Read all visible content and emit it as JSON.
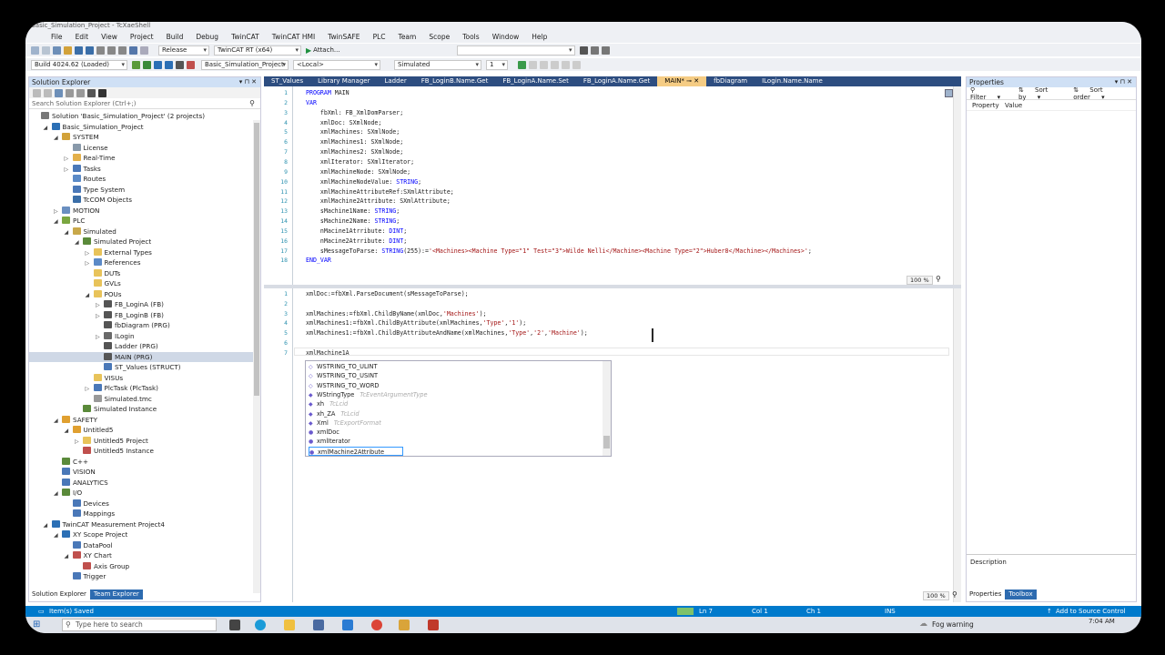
{
  "title": "Basic_Simulation_Project - TcXaeShell",
  "menu": [
    "File",
    "Edit",
    "View",
    "Project",
    "Build",
    "Debug",
    "TwinCAT",
    "TwinCAT HMI",
    "TwinSAFE",
    "PLC",
    "Team",
    "Scope",
    "Tools",
    "Window",
    "Help"
  ],
  "toolbar1": {
    "config": "Release",
    "platform": "TwinCAT RT (x64)",
    "attach": "Attach..."
  },
  "toolbar2": {
    "build": "Build 4024.62 (Loaded)",
    "project": "Basic_Simulation_Project",
    "target": "<Local>",
    "mode": "Simulated",
    "instance": "1"
  },
  "solution_explorer": {
    "title": "Solution Explorer",
    "controls": "▾ ⊓ ✕",
    "search_placeholder": "Search Solution Explorer (Ctrl+;)",
    "items": [
      {
        "label": "Solution 'Basic_Simulation_Project' (2 projects)",
        "level": 0,
        "arrow": "",
        "icon": "#777"
      },
      {
        "label": "Basic_Simulation_Project",
        "level": 1,
        "arrow": "◢",
        "icon": "#2b6fb5"
      },
      {
        "label": "SYSTEM",
        "level": 2,
        "arrow": "◢",
        "icon": "#d2a23a"
      },
      {
        "label": "License",
        "level": 3,
        "arrow": "",
        "icon": "#8899aa"
      },
      {
        "label": "Real-Time",
        "level": 3,
        "arrow": "▷",
        "icon": "#e3b04b"
      },
      {
        "label": "Tasks",
        "level": 3,
        "arrow": "▷",
        "icon": "#4a78b8"
      },
      {
        "label": "Routes",
        "level": 3,
        "arrow": "",
        "icon": "#5b8ac7"
      },
      {
        "label": "Type System",
        "level": 3,
        "arrow": "",
        "icon": "#4a78b8"
      },
      {
        "label": "TcCOM Objects",
        "level": 3,
        "arrow": "",
        "icon": "#3a6ea8"
      },
      {
        "label": "MOTION",
        "level": 2,
        "arrow": "▷",
        "icon": "#6a8fc0"
      },
      {
        "label": "PLC",
        "level": 2,
        "arrow": "◢",
        "icon": "#7aa640"
      },
      {
        "label": "Simulated",
        "level": 3,
        "arrow": "◢",
        "icon": "#c8a84a"
      },
      {
        "label": "Simulated Project",
        "level": 4,
        "arrow": "◢",
        "icon": "#5a8a3a"
      },
      {
        "label": "External Types",
        "level": 5,
        "arrow": "▷",
        "icon": "#e8c35a"
      },
      {
        "label": "References",
        "level": 5,
        "arrow": "▷",
        "icon": "#5b8ac7"
      },
      {
        "label": "DUTs",
        "level": 5,
        "arrow": "",
        "icon": "#e8c35a"
      },
      {
        "label": "GVLs",
        "level": 5,
        "arrow": "",
        "icon": "#e8c35a"
      },
      {
        "label": "POUs",
        "level": 5,
        "arrow": "◢",
        "icon": "#e8c35a"
      },
      {
        "label": "FB_LoginA (FB)",
        "level": 6,
        "arrow": "▷",
        "icon": "#555"
      },
      {
        "label": "FB_LoginB (FB)",
        "level": 6,
        "arrow": "▷",
        "icon": "#555"
      },
      {
        "label": "fbDiagram (PRG)",
        "level": 6,
        "arrow": "",
        "icon": "#555"
      },
      {
        "label": "ILogin",
        "level": 6,
        "arrow": "▷",
        "icon": "#6a6a6a"
      },
      {
        "label": "Ladder (PRG)",
        "level": 6,
        "arrow": "",
        "icon": "#555"
      },
      {
        "label": "MAIN (PRG)",
        "level": 6,
        "arrow": "",
        "icon": "#555",
        "selected": true
      },
      {
        "label": "ST_Values (STRUCT)",
        "level": 6,
        "arrow": "",
        "icon": "#4a78b8"
      },
      {
        "label": "VISUs",
        "level": 5,
        "arrow": "",
        "icon": "#e8c35a"
      },
      {
        "label": "PlcTask (PlcTask)",
        "level": 5,
        "arrow": "▷",
        "icon": "#4a78b8"
      },
      {
        "label": "Simulated.tmc",
        "level": 5,
        "arrow": "",
        "icon": "#999"
      },
      {
        "label": "Simulated Instance",
        "level": 4,
        "arrow": "",
        "icon": "#5a8a3a"
      },
      {
        "label": "SAFETY",
        "level": 2,
        "arrow": "◢",
        "icon": "#e0a030"
      },
      {
        "label": "Untitled5",
        "level": 3,
        "arrow": "◢",
        "icon": "#e0a030"
      },
      {
        "label": "Untitled5 Project",
        "level": 4,
        "arrow": "▷",
        "icon": "#e8c35a"
      },
      {
        "label": "Untitled5 Instance",
        "level": 4,
        "arrow": "",
        "icon": "#c0504d"
      },
      {
        "label": "C++",
        "level": 2,
        "arrow": "",
        "icon": "#5a8a3a"
      },
      {
        "label": "VISION",
        "level": 2,
        "arrow": "",
        "icon": "#4a78b8"
      },
      {
        "label": "ANALYTICS",
        "level": 2,
        "arrow": "",
        "icon": "#4a78b8"
      },
      {
        "label": "I/O",
        "level": 2,
        "arrow": "◢",
        "icon": "#5a8a3a"
      },
      {
        "label": "Devices",
        "level": 3,
        "arrow": "",
        "icon": "#4a78b8"
      },
      {
        "label": "Mappings",
        "level": 3,
        "arrow": "",
        "icon": "#4a78b8"
      },
      {
        "label": "TwinCAT Measurement Project4",
        "level": 1,
        "arrow": "◢",
        "icon": "#2b6fb5"
      },
      {
        "label": "XY Scope Project",
        "level": 2,
        "arrow": "◢",
        "icon": "#2b6fb5"
      },
      {
        "label": "DataPool",
        "level": 3,
        "arrow": "",
        "icon": "#4a78b8"
      },
      {
        "label": "XY Chart",
        "level": 3,
        "arrow": "◢",
        "icon": "#c0504d"
      },
      {
        "label": "Axis Group",
        "level": 4,
        "arrow": "",
        "icon": "#c0504d"
      },
      {
        "label": "Trigger",
        "level": 3,
        "arrow": "",
        "icon": "#4a78b8"
      }
    ],
    "tabs": [
      "Solution Explorer",
      "Team Explorer"
    ]
  },
  "editor_tabs": [
    "ST_Values",
    "Library Manager",
    "Ladder",
    "FB_LoginB.Name.Get",
    "FB_LoginA.Name.Set",
    "FB_LoginA.Name.Get",
    "MAIN*",
    "fbDiagram",
    "ILogin.Name.Name"
  ],
  "active_tab_index": 6,
  "decl_lines": [
    {
      "n": "1",
      "t": "PROGRAM MAIN"
    },
    {
      "n": "2",
      "t": "VAR"
    },
    {
      "n": "3",
      "t": "    fbXml: FB_XmlDomParser;"
    },
    {
      "n": "4",
      "t": "    xmlDoc: SXmlNode;"
    },
    {
      "n": "5",
      "t": "    xmlMachines: SXmlNode;"
    },
    {
      "n": "6",
      "t": "    xmlMachines1: SXmlNode;"
    },
    {
      "n": "7",
      "t": "    xmlMachines2: SXmlNode;"
    },
    {
      "n": "8",
      "t": "    xmlIterator: SXmlIterator;"
    },
    {
      "n": "9",
      "t": "    xmlMachineNode: SXmlNode;"
    },
    {
      "n": "10",
      "t": "    xmlMachineNodeValue: STRING;"
    },
    {
      "n": "11",
      "t": "    xmlMachineAttributeRef:SXmlAttribute;"
    },
    {
      "n": "12",
      "t": "    xmlMachine2Attribute: SXmlAttribute;"
    },
    {
      "n": "13",
      "t": "    sMachine1Name: STRING;"
    },
    {
      "n": "14",
      "t": "    sMachine2Name: STRING;"
    },
    {
      "n": "15",
      "t": "    nMacine1Atrribute: DINT;"
    },
    {
      "n": "16",
      "t": "    nMacine2Atrribute: DINT;"
    },
    {
      "n": "17",
      "t": "    sMessageToParse: STRING(255):='<Machines><Machine Type=\"1\" Test=\"3\">Wilde Nelli</Machine><Machine Type=\"2\">Huber8</Machine></Machines>';"
    },
    {
      "n": "18",
      "t": "END_VAR"
    }
  ],
  "impl_lines": [
    {
      "n": "1",
      "t": "xmlDoc:=fbXml.ParseDocument(sMessageToParse);"
    },
    {
      "n": "2",
      "t": ""
    },
    {
      "n": "3",
      "t": "xmlMachines:=fbXml.ChildByName(xmlDoc,'Machines');"
    },
    {
      "n": "4",
      "t": "xmlMachines1:=fbXml.ChildByAttribute(xmlMachines,'Type','1');"
    },
    {
      "n": "5",
      "t": "xmlMachines1:=fbXml.ChildByAttributeAndName(xmlMachines,'Type','2','Machine');"
    },
    {
      "n": "6",
      "t": ""
    },
    {
      "n": "7",
      "t": "xmlMachine1A"
    }
  ],
  "zoom_top": "100 %",
  "zoom_bottom": "100 %",
  "autocomplete": [
    {
      "label": "WSTRING_TO_ULINT",
      "hint": ""
    },
    {
      "label": "WSTRING_TO_USINT",
      "hint": ""
    },
    {
      "label": "WSTRING_TO_WORD",
      "hint": ""
    },
    {
      "label": "WStringType",
      "hint": "TcEventArgumentType"
    },
    {
      "label": "xh",
      "hint": "TcLcid"
    },
    {
      "label": "xh_ZA",
      "hint": "TcLcid"
    },
    {
      "label": "Xml",
      "hint": "TcExportFormat"
    },
    {
      "label": "xmlDoc",
      "hint": ""
    },
    {
      "label": "xmlIterator",
      "hint": ""
    },
    {
      "label": "xmlMachine2Attribute",
      "hint": "",
      "selected": true
    }
  ],
  "properties": {
    "title": "Properties",
    "filter": "Filter",
    "sort_by": "Sort by",
    "sort_order": "Sort order",
    "col_property": "Property",
    "col_value": "Value",
    "description": "Description",
    "tabs": [
      "Properties",
      "Toolbox"
    ]
  },
  "status": {
    "left": "Item(s) Saved",
    "ln": "Ln 7",
    "col": "Col 1",
    "ch": "Ch 1",
    "ins": "INS",
    "source": "Add to Source Control"
  },
  "taskbar": {
    "search": "Type here to search",
    "weather": "Fog warning",
    "time": "7:04 AM"
  },
  "colors": {
    "accent": "#007acc",
    "tabbar": "#2d4d80",
    "active_tab": "#f5cc84"
  }
}
